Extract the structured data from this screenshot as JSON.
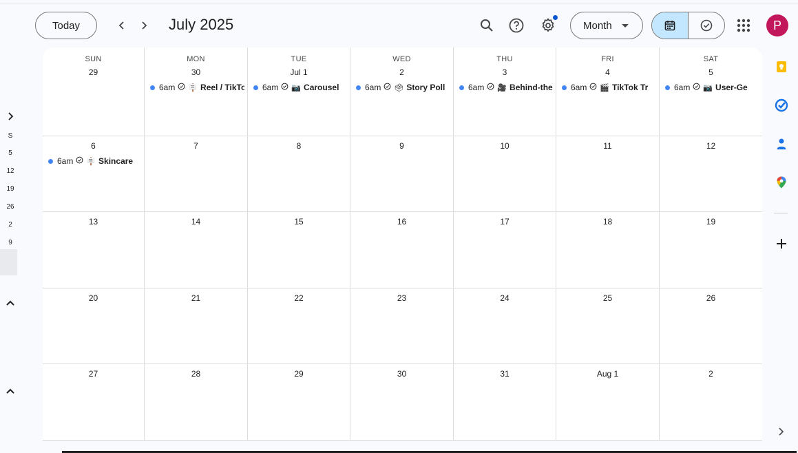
{
  "header": {
    "today_label": "Today",
    "month_title": "July 2025",
    "view_label": "Month",
    "avatar_letter": "P"
  },
  "colors": {
    "accent": "#0b57d0",
    "event_dot": "#4285f4",
    "avatar": "#c2185b",
    "toggle_active": "#c2e7ff"
  },
  "mini_sidebar": {
    "day_letter": "S",
    "numbers": [
      "5",
      "12",
      "19",
      "26",
      "2",
      "9"
    ]
  },
  "weekdays": [
    "SUN",
    "MON",
    "TUE",
    "WED",
    "THU",
    "FRI",
    "SAT"
  ],
  "weeks": [
    [
      {
        "label": "29",
        "events": []
      },
      {
        "label": "30",
        "events": [
          {
            "time": "6am",
            "emoji": "🪧",
            "title": "Reel / TikTok"
          }
        ]
      },
      {
        "label": "Jul 1",
        "events": [
          {
            "time": "6am",
            "emoji": "📷",
            "title": "Carousel"
          }
        ]
      },
      {
        "label": "2",
        "events": [
          {
            "time": "6am",
            "emoji": "🗳",
            "title": "Story Poll"
          }
        ]
      },
      {
        "label": "3",
        "events": [
          {
            "time": "6am",
            "emoji": "🎥",
            "title": "Behind-the"
          }
        ]
      },
      {
        "label": "4",
        "events": [
          {
            "time": "6am",
            "emoji": "🎬",
            "title": "TikTok Tr"
          }
        ]
      },
      {
        "label": "5",
        "events": [
          {
            "time": "6am",
            "emoji": "📷",
            "title": "User-Ge"
          }
        ]
      }
    ],
    [
      {
        "label": "6",
        "events": [
          {
            "time": "6am",
            "emoji": "🪧",
            "title": "Skincare"
          }
        ]
      },
      {
        "label": "7",
        "events": []
      },
      {
        "label": "8",
        "events": []
      },
      {
        "label": "9",
        "events": []
      },
      {
        "label": "10",
        "events": []
      },
      {
        "label": "11",
        "events": []
      },
      {
        "label": "12",
        "events": []
      }
    ],
    [
      {
        "label": "13",
        "events": []
      },
      {
        "label": "14",
        "events": []
      },
      {
        "label": "15",
        "events": []
      },
      {
        "label": "16",
        "events": []
      },
      {
        "label": "17",
        "events": []
      },
      {
        "label": "18",
        "events": []
      },
      {
        "label": "19",
        "events": []
      }
    ],
    [
      {
        "label": "20",
        "events": []
      },
      {
        "label": "21",
        "events": []
      },
      {
        "label": "22",
        "events": []
      },
      {
        "label": "23",
        "events": []
      },
      {
        "label": "24",
        "events": []
      },
      {
        "label": "25",
        "events": []
      },
      {
        "label": "26",
        "events": []
      }
    ],
    [
      {
        "label": "27",
        "events": []
      },
      {
        "label": "28",
        "events": []
      },
      {
        "label": "29",
        "events": []
      },
      {
        "label": "30",
        "events": []
      },
      {
        "label": "31",
        "events": []
      },
      {
        "label": "Aug 1",
        "events": []
      },
      {
        "label": "2",
        "events": []
      }
    ]
  ],
  "side_panel": {
    "icons": [
      "keep-icon",
      "tasks-icon",
      "contacts-icon",
      "maps-icon"
    ]
  }
}
